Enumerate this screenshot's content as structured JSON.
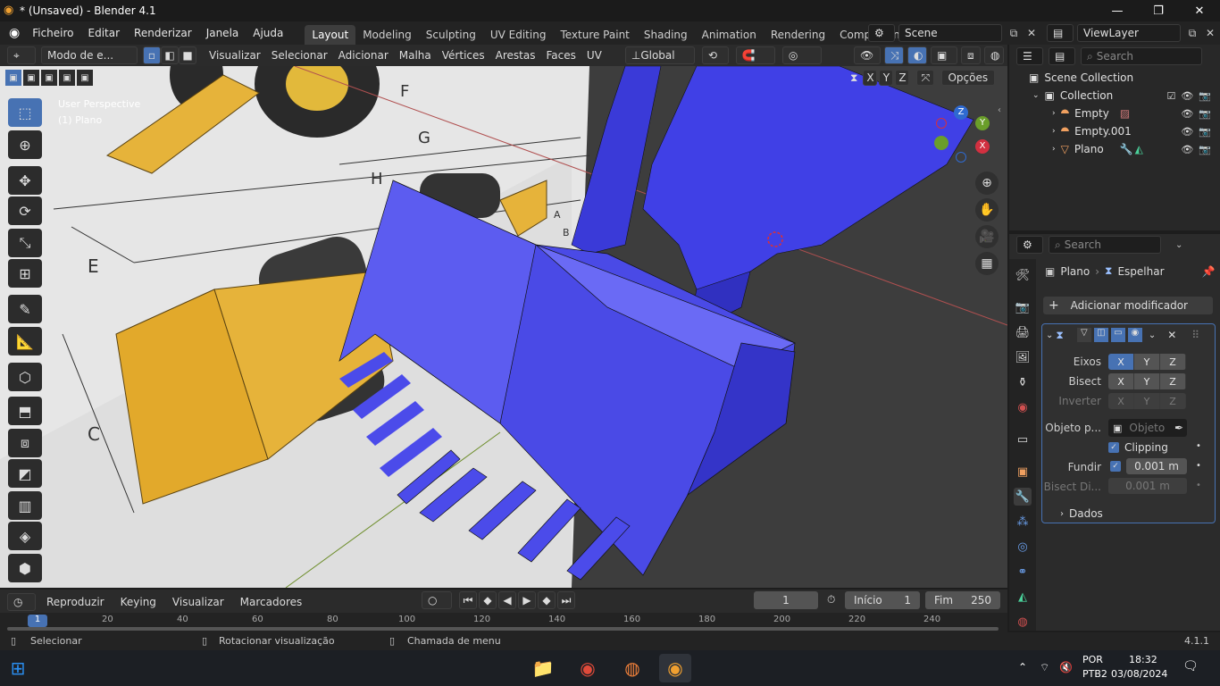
{
  "window": {
    "title": "* (Unsaved) - Blender 4.1",
    "minimize": "—",
    "maximize": "❐",
    "close": "✕"
  },
  "menu": [
    "Ficheiro",
    "Editar",
    "Renderizar",
    "Janela",
    "Ajuda"
  ],
  "workspaces": [
    "Layout",
    "Modeling",
    "Sculpting",
    "UV Editing",
    "Texture Paint",
    "Shading",
    "Animation",
    "Rendering",
    "Compositing"
  ],
  "scene": {
    "name": "Scene",
    "view_layer": "ViewLayer"
  },
  "viewport_header": {
    "mode": "Modo de e...",
    "menus": [
      "Visualizar",
      "Selecionar",
      "Adicionar",
      "Malha",
      "Vértices",
      "Arestas",
      "Faces",
      "UV"
    ],
    "transform": "Global",
    "mirror_axes": [
      "X",
      "Y",
      "Z"
    ],
    "options": "Opções"
  },
  "viewport": {
    "perspective": "User Perspective",
    "object": "(1) Plano",
    "dims": [
      "F",
      "G",
      "H",
      "E",
      "C",
      "A",
      "B"
    ],
    "gizmo": [
      "Z",
      "Y",
      "X"
    ]
  },
  "outliner": {
    "search_placeholder": "Search",
    "items": [
      "Scene Collection",
      "Collection",
      "Empty",
      "Empty.001",
      "Plano"
    ]
  },
  "properties": {
    "search_placeholder": "Search",
    "breadcrumb_object": "Plano",
    "breadcrumb_modifier": "Espelhar",
    "add_modifier": "Adicionar modificador",
    "labels": {
      "eixos": "Eixos",
      "bisect": "Bisect",
      "inverter": "Inverter",
      "objeto": "Objeto p...",
      "fundir": "Fundir",
      "bisect_dist": "Bisect Di...",
      "dados": "Dados"
    },
    "axes": [
      "X",
      "Y",
      "Z"
    ],
    "object_placeholder": "Objeto",
    "clipping": "Clipping",
    "fundir_value": "0.001 m",
    "bisect_value": "0.001 m"
  },
  "timeline": {
    "menus": [
      "Reproduzir",
      "Keying",
      "Visualizar",
      "Marcadores"
    ],
    "current_frame": "1",
    "start_label": "Início",
    "start": "1",
    "end_label": "Fim",
    "end": "250",
    "ticks": [
      "1",
      "20",
      "40",
      "60",
      "80",
      "100",
      "120",
      "140",
      "160",
      "180",
      "200",
      "220",
      "240"
    ]
  },
  "status": {
    "select": "Selecionar",
    "rotate": "Rotacionar visualização",
    "menu": "Chamada de menu",
    "version": "4.1.1"
  },
  "taskbar": {
    "lang": "POR",
    "layout": "PTB2",
    "time": "18:32",
    "date": "03/08/2024"
  }
}
